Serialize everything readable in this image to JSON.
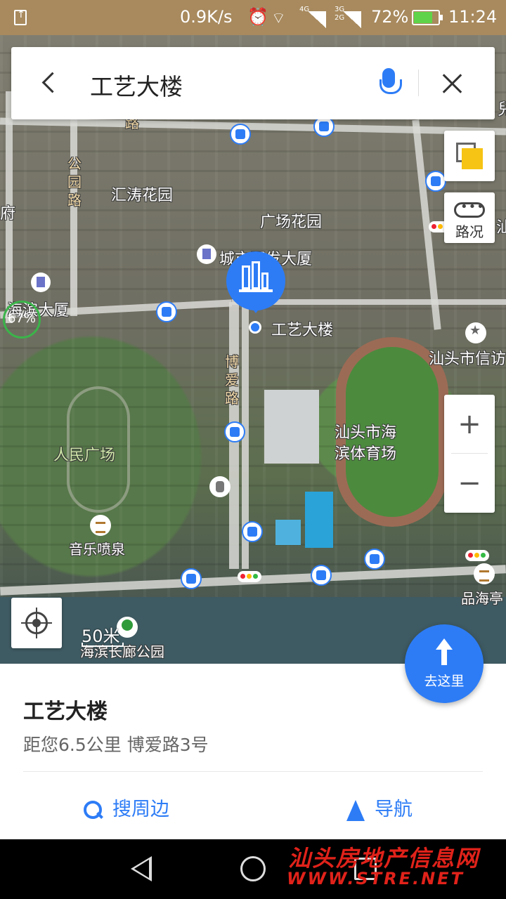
{
  "status_bar": {
    "net_speed": "0.9K/s",
    "network_1": "4G",
    "network_2a": "3G",
    "network_2b": "2G",
    "battery_pct": "72%",
    "battery_level": 0.72,
    "time": "11:24"
  },
  "search": {
    "query": "工艺大楼"
  },
  "map": {
    "labels": {
      "park_road": "公\n园\n路",
      "huitao_garden": "汇涛花园",
      "square_garden": "广场花园",
      "city_dev_building": "城市开发大厦",
      "haibin_building": "海滨大厦",
      "selected_poi": "工艺大楼",
      "boai_road": "博\n爱\n路",
      "petition_office": "汕头市信访",
      "stadium": "汕头市海\n滨体育场",
      "peoples_square": "人民广场",
      "music_fountain": "音乐喷泉",
      "pinhaiting": "品海亭",
      "corridor_park": "海滨长廊公园",
      "left_edge": "府",
      "top_road": "路",
      "right_top": "兒",
      "right_edge": "汕"
    },
    "pct_badge": "67%",
    "scale": "50米",
    "traffic_label": "路况",
    "zoom_in": "+",
    "zoom_out": "−"
  },
  "go_button": {
    "label": "去这里"
  },
  "detail": {
    "name": "工艺大楼",
    "distance_address": "距您6.5公里  博爱路3号",
    "search_nearby": "搜周边",
    "navigate": "导航"
  },
  "watermark": {
    "line1": "汕头房地产信息网",
    "line2": "WWW.STRE.NET"
  },
  "colors": {
    "accent": "#2d7cf6",
    "status_bar": "#a88a5e"
  }
}
